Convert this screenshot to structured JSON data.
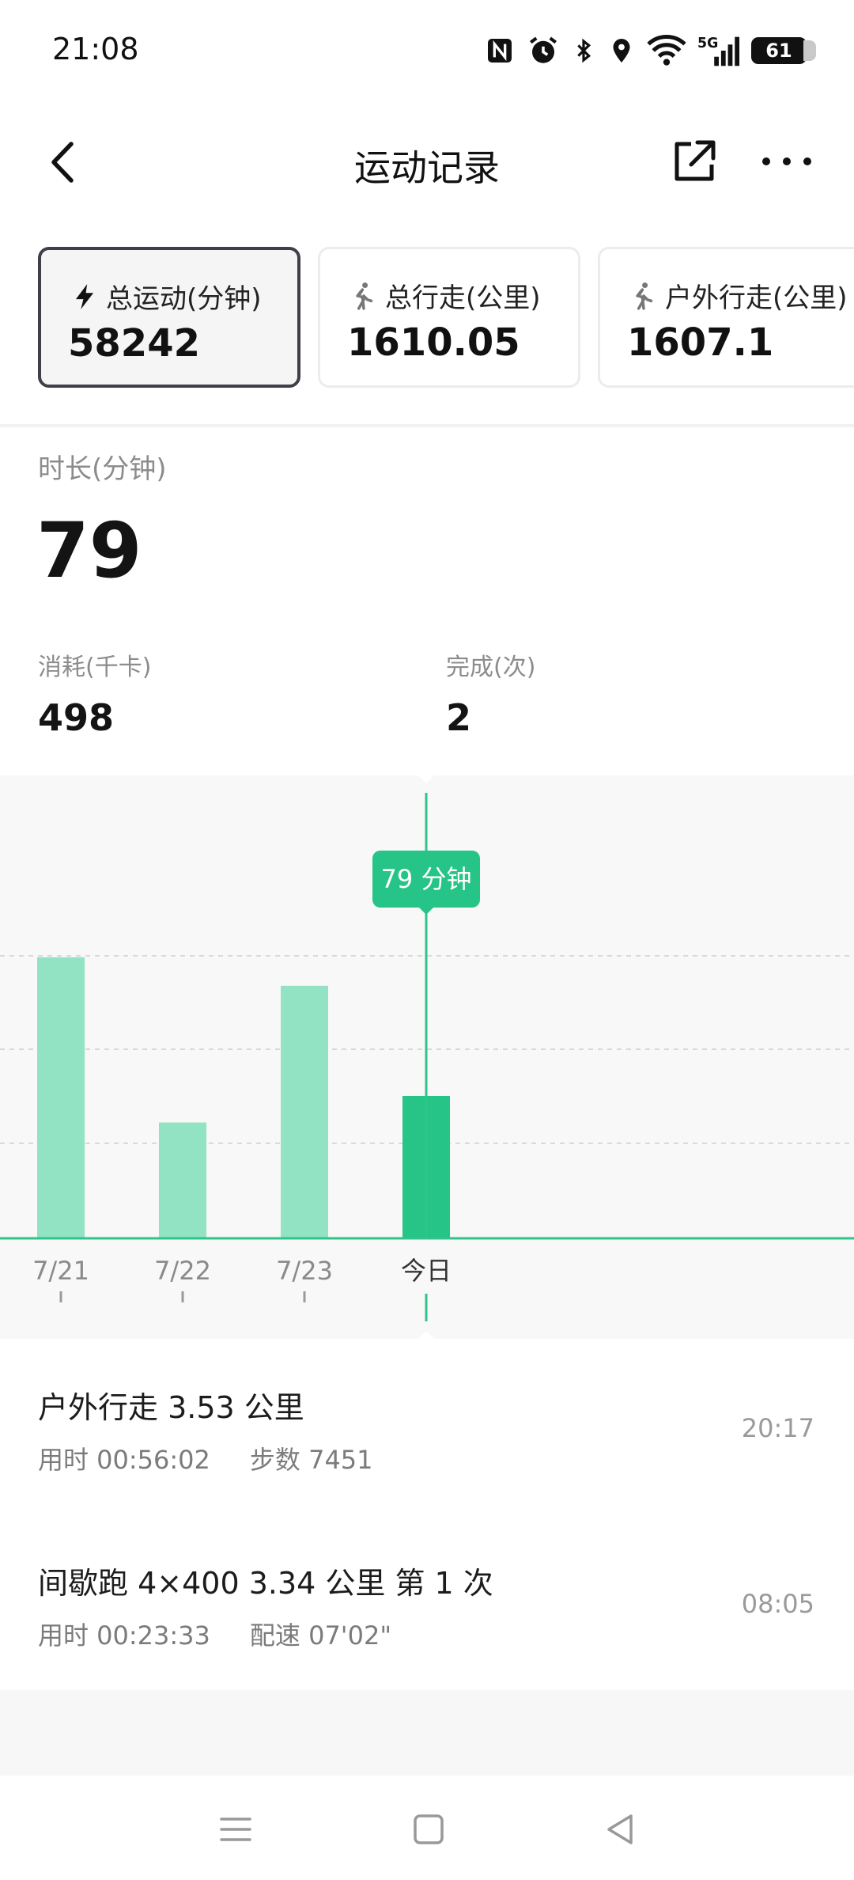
{
  "status": {
    "time": "21:08",
    "battery": "61",
    "icons": [
      "nfc-icon",
      "alarm-icon",
      "bluetooth-icon",
      "location-icon",
      "wifi-icon",
      "signal-5g-icon",
      "battery-icon"
    ],
    "signal_label": "5G"
  },
  "appbar": {
    "title": "运动记录"
  },
  "cards": [
    {
      "label": "总运动(分钟)",
      "value": "58242",
      "icon": "bolt-icon",
      "selected": true
    },
    {
      "label": "总行走(公里)",
      "value": "1610.05",
      "icon": "walk-icon",
      "selected": false
    },
    {
      "label": "户外行走(公里)",
      "value": "1607.1",
      "icon": "walk-icon",
      "selected": false
    }
  ],
  "summary": {
    "duration_label": "时长(分钟)",
    "duration_value": "79",
    "kcal_label": "消耗(千卡)",
    "kcal_value": "498",
    "done_label": "完成(次)",
    "done_value": "2"
  },
  "chart_data": {
    "type": "bar",
    "categories": [
      "7/21",
      "7/22",
      "7/23",
      "今日"
    ],
    "values": [
      148,
      61,
      133,
      75
    ],
    "selected_index": 3,
    "tooltip": "79 分钟",
    "colors": {
      "bar": "#92e3c3",
      "bar_selected": "#26c486",
      "axis": "#2ec48a",
      "grid": "#d9d9d9",
      "background": "#f8f8f8"
    }
  },
  "records": [
    {
      "title": "户外行走 3.53 公里",
      "duration": "用时 00:56:02",
      "extra": "步数 7451",
      "time": "20:17"
    },
    {
      "title": "间歇跑 4×400  3.34 公里 第 1 次",
      "duration": "用时 00:23:33",
      "extra": "配速 07'02\"",
      "time": "08:05"
    }
  ],
  "navbar": {
    "icons": [
      "menu-icon",
      "home-icon",
      "back-triangle-icon"
    ]
  }
}
